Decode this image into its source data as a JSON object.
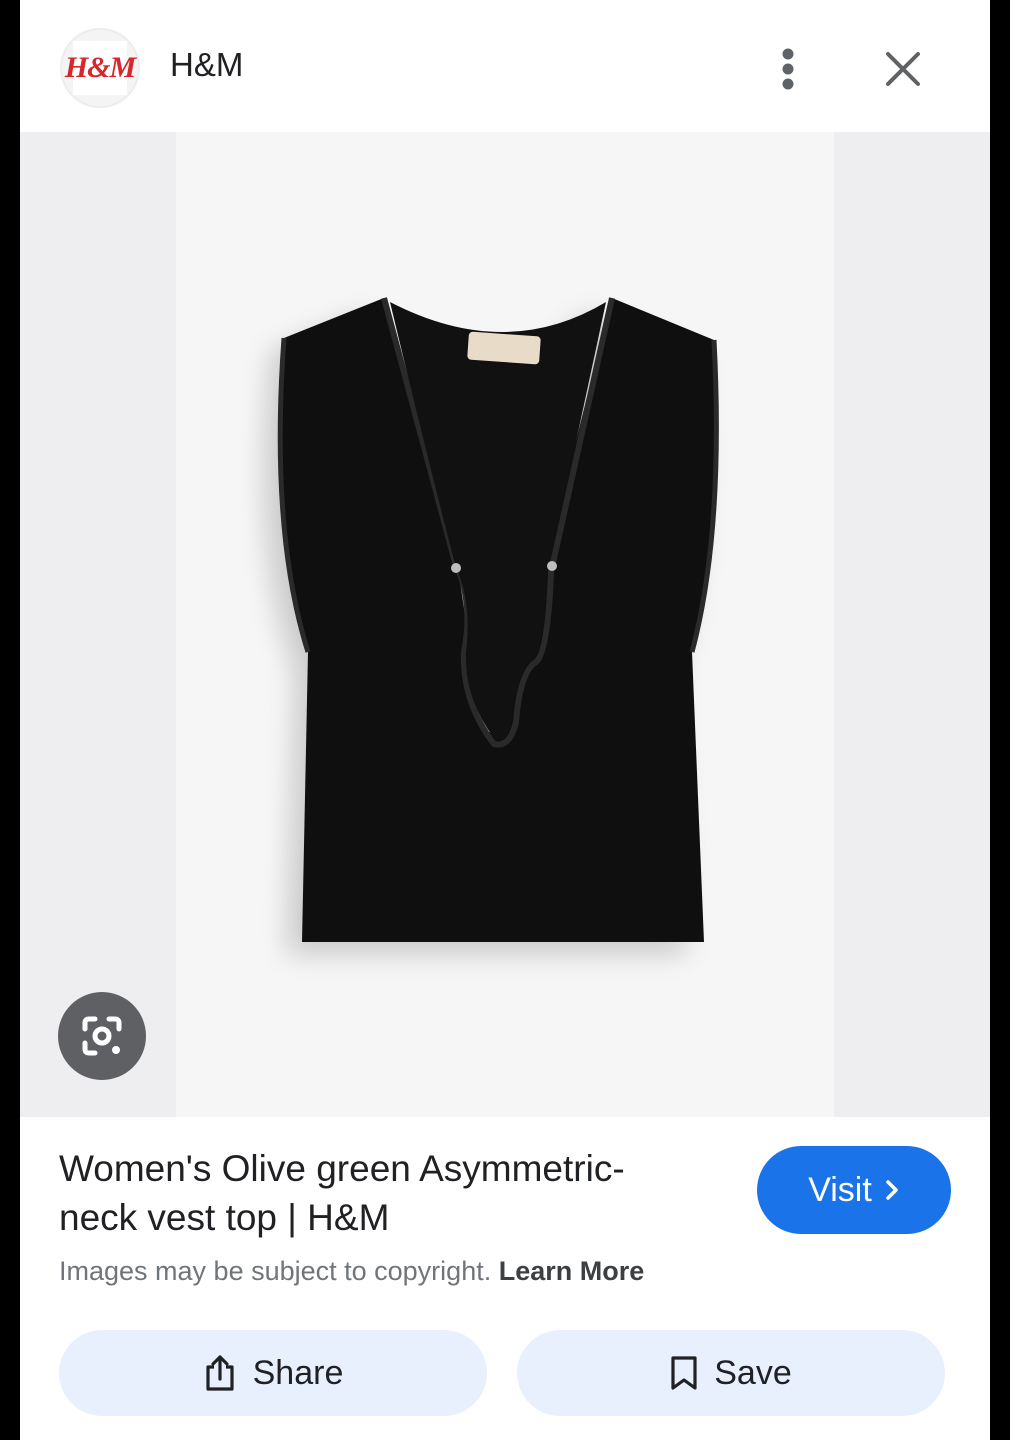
{
  "header": {
    "logo_text": "H&M",
    "site_name": "H&M"
  },
  "result": {
    "title": "Women's Olive green Asymmetric-neck vest top | H&M",
    "visit_label": "Visit",
    "copyright_text": "Images may be subject to copyright.",
    "learn_more_label": "Learn More"
  },
  "actions": {
    "share_label": "Share",
    "save_label": "Save"
  },
  "colors": {
    "brand_red": "#d9262c",
    "visit_blue": "#1a73e8",
    "action_bg": "#e8f0fe"
  }
}
